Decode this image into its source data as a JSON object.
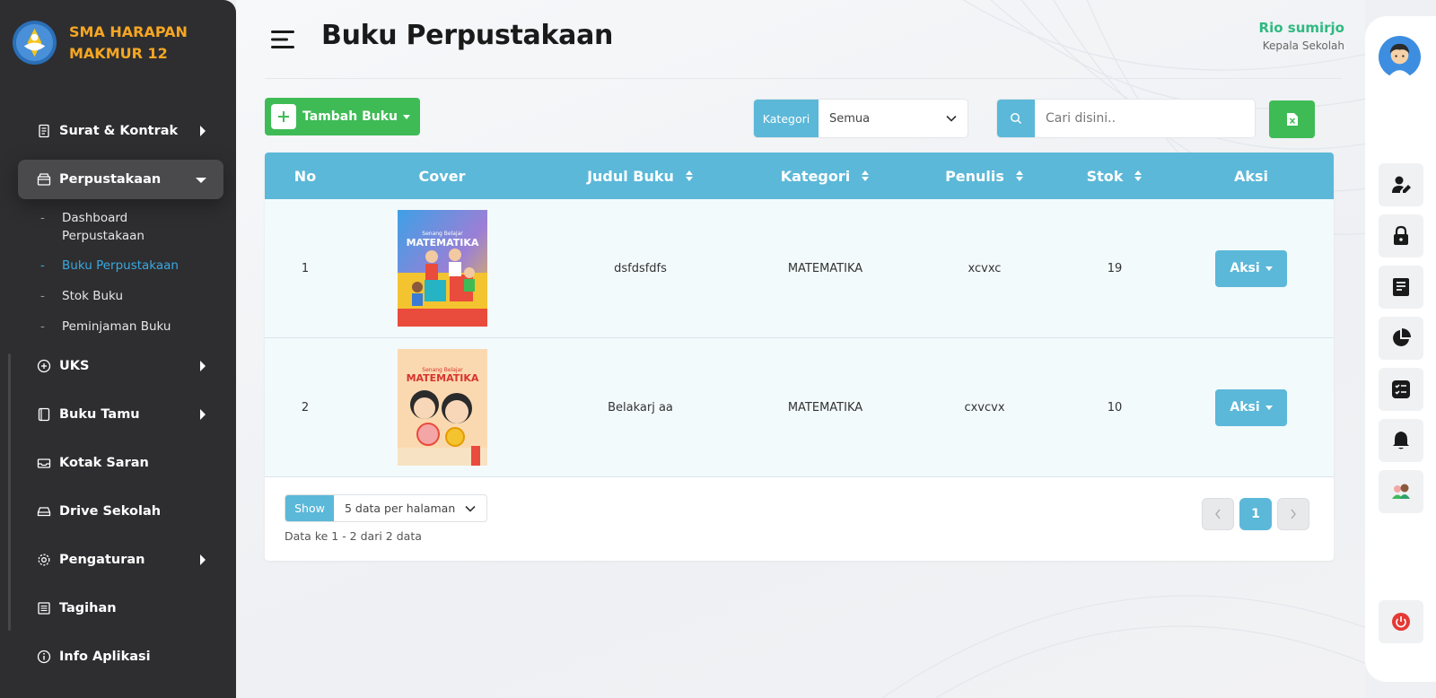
{
  "app": {
    "school_name": "SMA HARAPAN MAKMUR 12",
    "page_title": "Buku Perpustakaan"
  },
  "user": {
    "name": "Rio sumirjo",
    "role": "Kepala Sekolah"
  },
  "sidebar": {
    "items": [
      {
        "label": "Surat & Kontrak",
        "icon": "document-icon",
        "has_arrow": true
      },
      {
        "label": "Perpustakaan",
        "icon": "archive-box-icon",
        "active": true,
        "expanded": true
      },
      {
        "label": "UKS",
        "icon": "plus-circle-icon",
        "has_arrow": true
      },
      {
        "label": "Buku Tamu",
        "icon": "book-icon",
        "has_arrow": true
      },
      {
        "label": "Kotak Saran",
        "icon": "inbox-icon"
      },
      {
        "label": "Drive Sekolah",
        "icon": "hard-drive-icon"
      },
      {
        "label": "Pengaturan",
        "icon": "gear-icon",
        "has_arrow": true
      },
      {
        "label": "Tagihan",
        "icon": "receipt-icon"
      },
      {
        "label": "Info Aplikasi",
        "icon": "info-icon"
      }
    ],
    "sub_items": [
      {
        "label": "Dashboard Perpustakaan"
      },
      {
        "label": "Buku Perpustakaan",
        "active": true
      },
      {
        "label": "Stok Buku"
      },
      {
        "label": "Peminjaman Buku"
      }
    ]
  },
  "toolbar": {
    "add_label": "Tambah Buku",
    "category_label": "Kategori",
    "category_value": "Semua",
    "search_placeholder": "Cari disini.."
  },
  "table": {
    "headers": [
      "No",
      "Cover",
      "Judul Buku",
      "Kategori",
      "Penulis",
      "Stok",
      "Aksi"
    ],
    "rows": [
      {
        "no": "1",
        "cover_title": "MATEMATIKA",
        "cover_subtitle": "Senang Belajar",
        "judul": "dsfdsfdfs",
        "kategori": "MATEMATIKA",
        "penulis": "xcvxc",
        "stok": "19",
        "aksi": "Aksi"
      },
      {
        "no": "2",
        "cover_title": "MATEMATIKA",
        "cover_subtitle": "Senang Belajar",
        "judul": "Belakarj aa",
        "kategori": "MATEMATIKA",
        "penulis": "cxvcvx",
        "stok": "10",
        "aksi": "Aksi"
      }
    ]
  },
  "pagination": {
    "show_label": "Show",
    "per_page": "5 data per halaman",
    "info": "Data ke 1 - 2 dari 2 data",
    "current_page": "1"
  },
  "right_panel": {
    "icons": [
      "user-edit-icon",
      "lock-icon",
      "report-icon",
      "pie-chart-icon",
      "checklist-icon",
      "bell-icon",
      "avatar-group-icon"
    ],
    "power": "power-icon"
  },
  "colors": {
    "sidebar_bg": "#2e2e30",
    "brand_orange": "#f5a623",
    "accent_blue": "#5bb8d8",
    "active_blue": "#3aa8e0",
    "green": "#3fbb55",
    "user_green": "#2fb981",
    "power_red": "#e53935"
  }
}
